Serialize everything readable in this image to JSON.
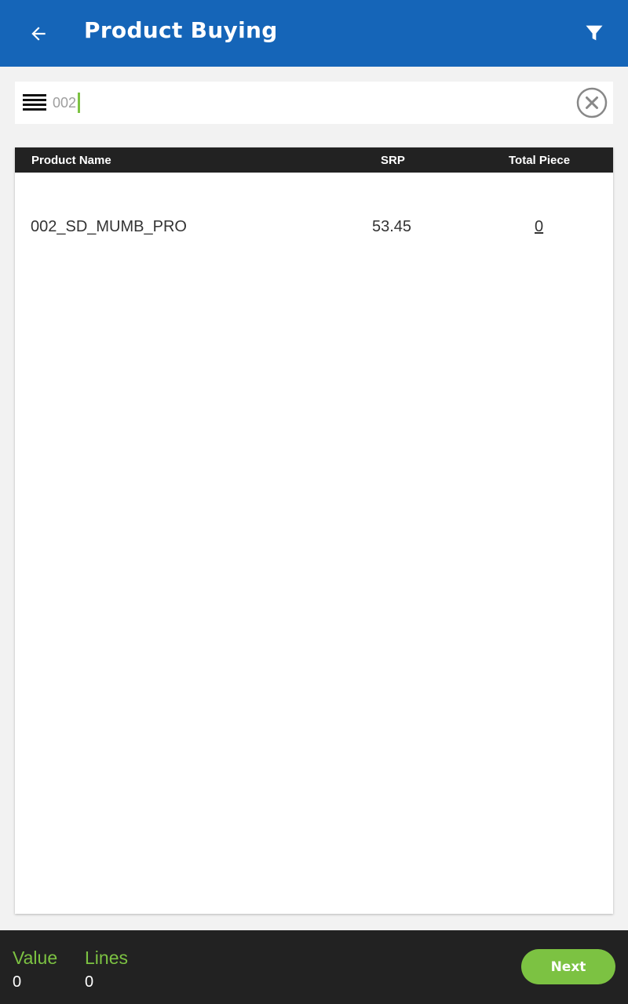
{
  "app_bar": {
    "title": "Product Buying",
    "back_icon": "arrow-left-icon",
    "filter_icon": "filter-icon",
    "color": "#1565b8"
  },
  "search": {
    "value": "002",
    "menu_icon": "menu-lines-icon",
    "clear_icon": "clear-circle-icon"
  },
  "table": {
    "columns": [
      "Product Name",
      "SRP",
      "Total Piece"
    ],
    "rows": [
      {
        "product_name": "002_SD_MUMB_PRO",
        "srp": "53.45",
        "total_piece": "0"
      }
    ]
  },
  "footer": {
    "value_label": "Value",
    "value": "0",
    "lines_label": "Lines",
    "lines": "0",
    "next_label": "Next",
    "accent": "#7cc242"
  }
}
